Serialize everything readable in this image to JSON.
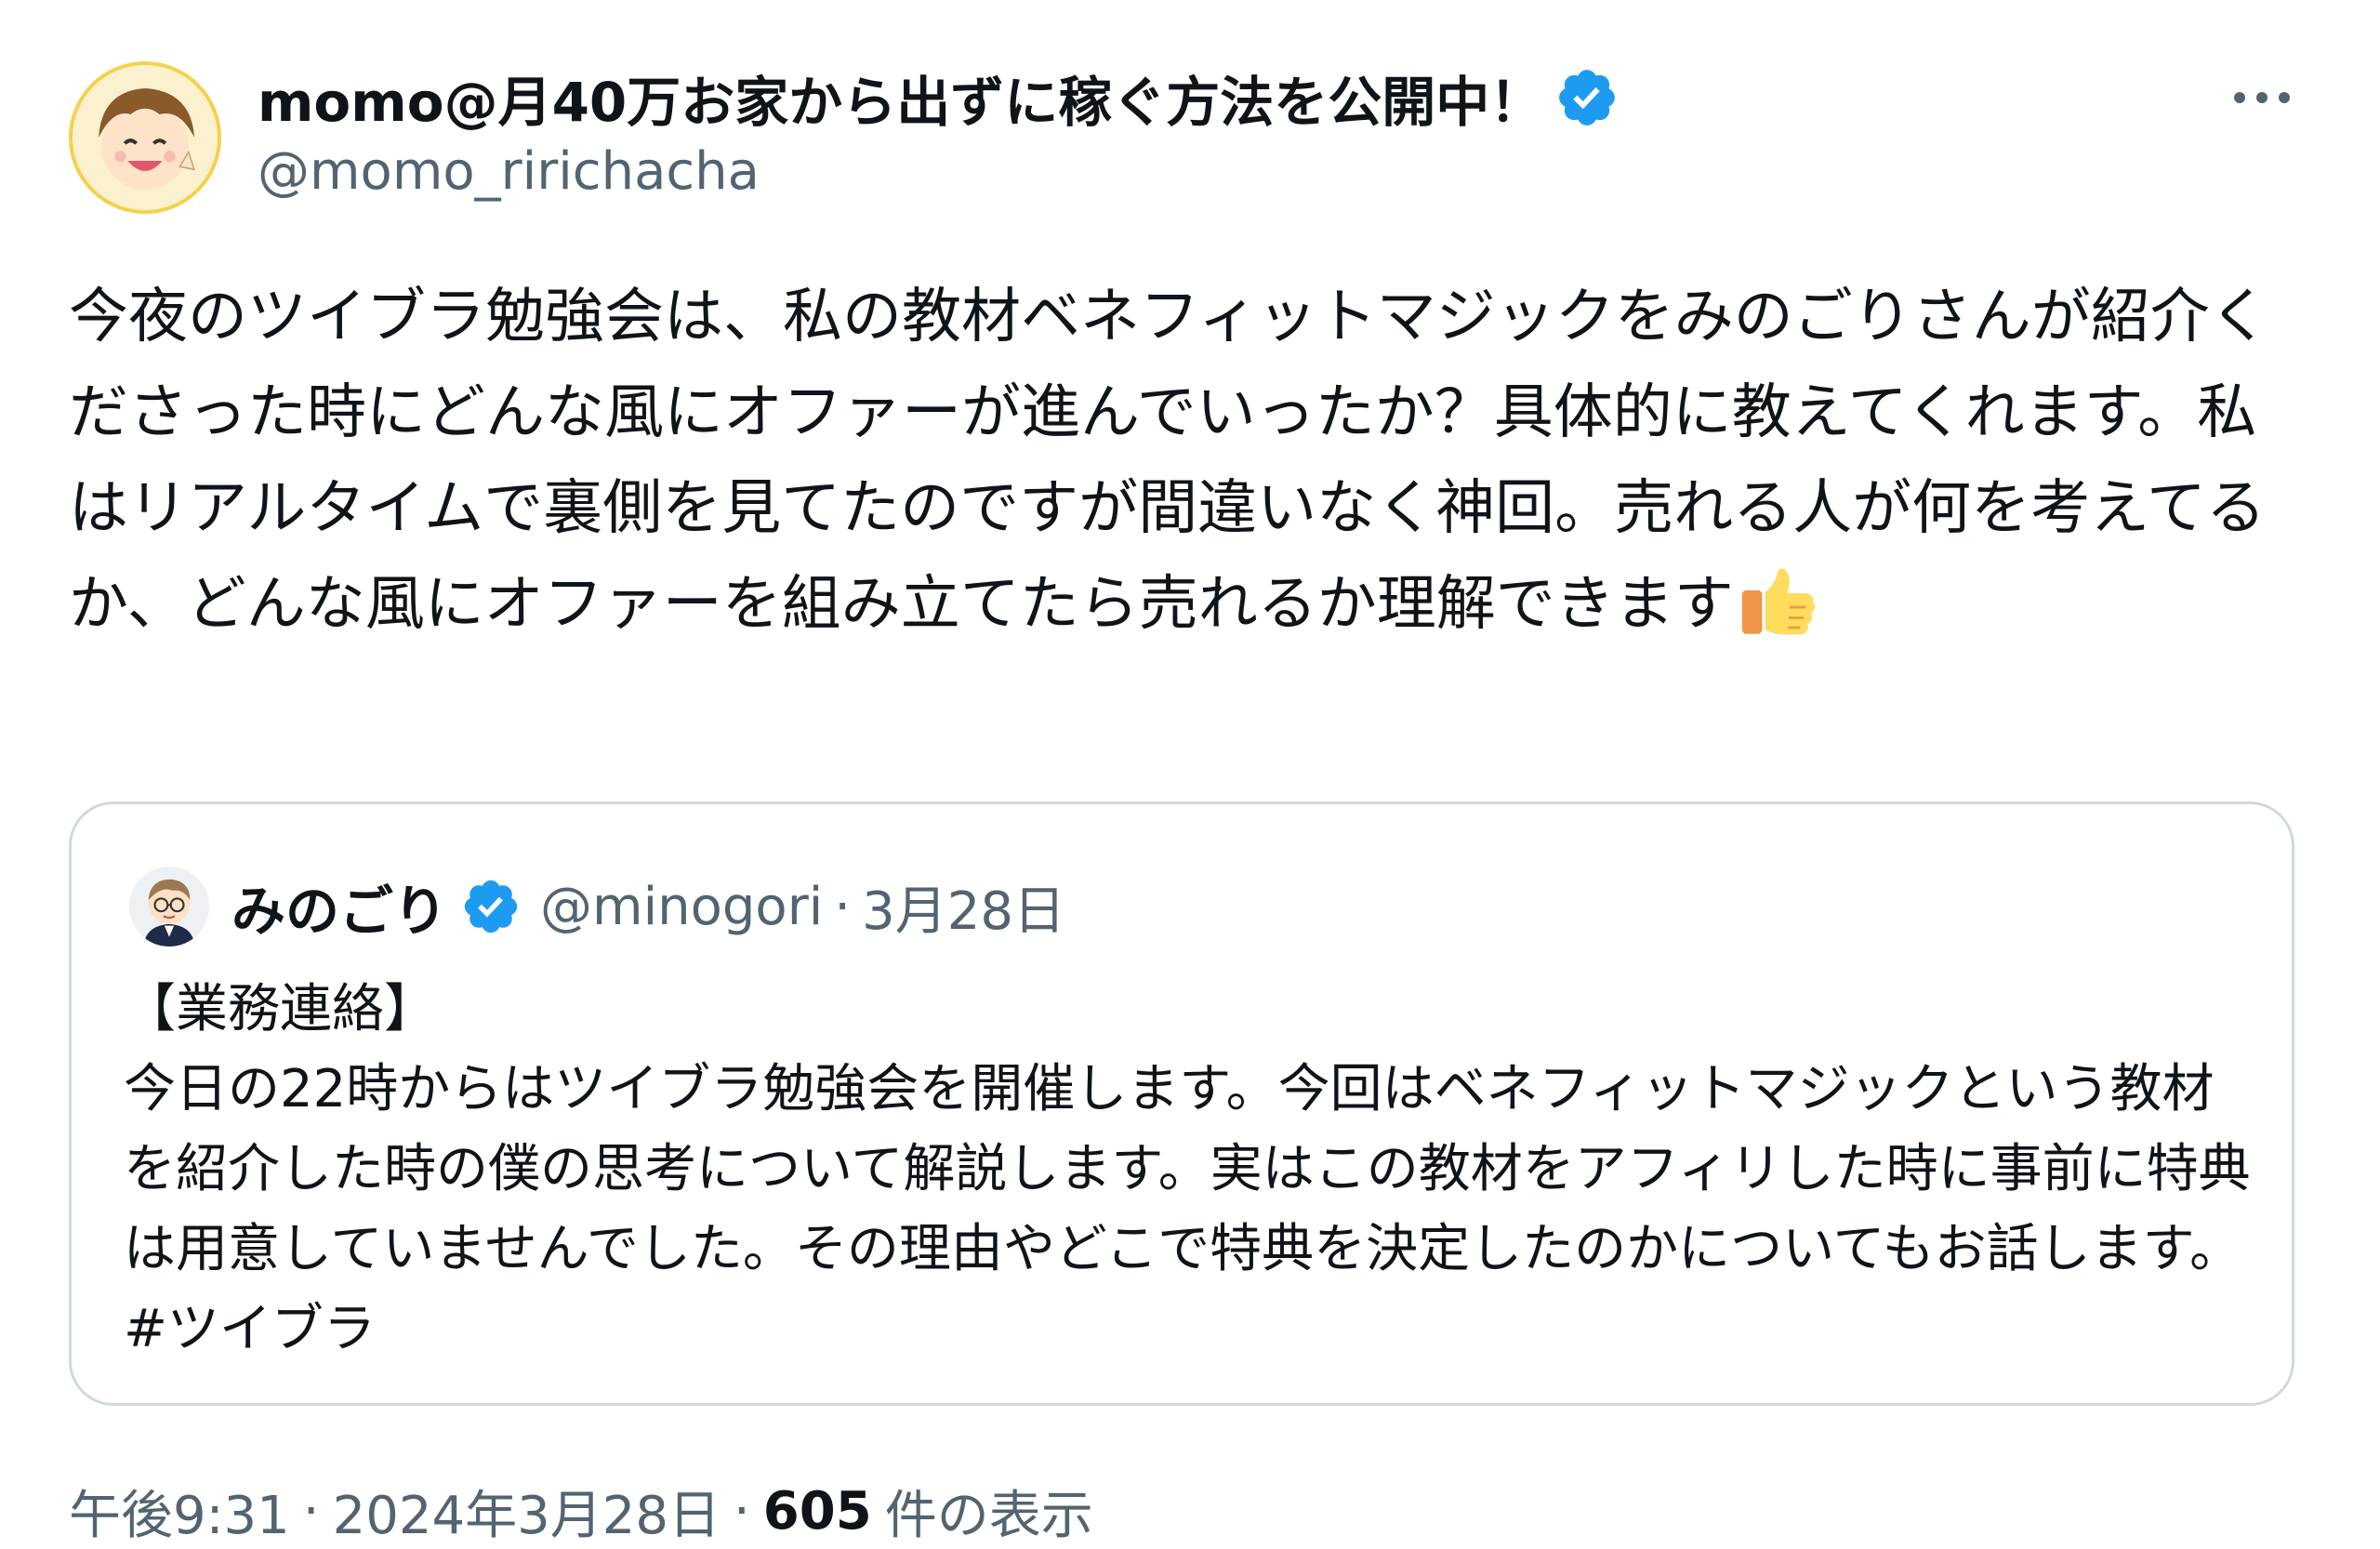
{
  "author": {
    "display_name": "momo@月40万お家から出ずに稼ぐ方法を公開中！",
    "handle": "@momo_ririchacha",
    "verified": true,
    "avatar_icon": "cartoon-face-avatar"
  },
  "more_icon": "more-horizontal-icon",
  "body": {
    "text": "今夜のツイブラ勉強会は、私の教材ベネフィットマジックをみのごりさんが紹介くださった時にどんな風にオファーが進んでいったか？具体的に教えてくれます。私はリアルタイムで裏側を見てたのですが間違いなく神回。売れる人が何を考えてるか、どんな風にオファーを組み立てたら売れるか理解できます",
    "emoji": "thumbs-up-icon"
  },
  "quote": {
    "display_name": "みのごり",
    "verified": true,
    "handle": "@minogori",
    "separator": "·",
    "date": "3月28日",
    "text": "【業務連絡】\n今日の22時からはツイブラ勉強会を開催します。今回はベネフィットマジックという教材を紹介した時の僕の思考について解説します。実はこの教材をアフィリした時に事前に特典は用意していませんでした。その理由やどこで特典を決定したのかについてもお話します。 #ツイブラ"
  },
  "meta": {
    "time": "午後9:31",
    "separator": "·",
    "date": "2024年3月28日",
    "views_count": "605",
    "views_label": "件の表示"
  },
  "colors": {
    "verified_blue": "#1d9bf0",
    "secondary_text": "#536471",
    "primary_text": "#0f1419",
    "border": "#cfd9de"
  }
}
